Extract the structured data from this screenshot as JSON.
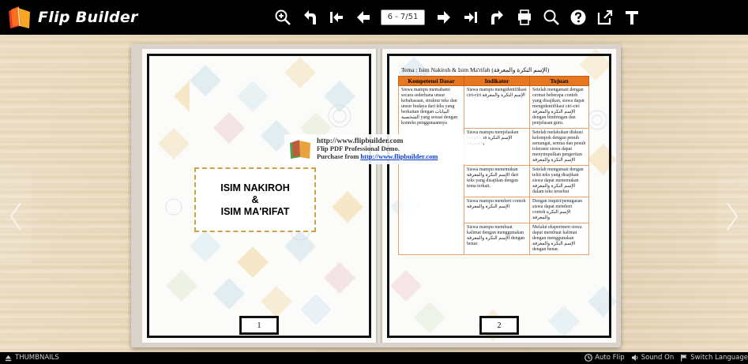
{
  "app": {
    "brand": "Flip Builder"
  },
  "toolbar": {
    "page_indicator": "6 - 7/51",
    "tools": [
      "zoom-in-icon",
      "undo-icon",
      "first-page-icon",
      "prev-page-icon",
      "page-input",
      "next-page-icon",
      "last-page-icon",
      "share-icon",
      "print-icon",
      "search-icon",
      "help-icon",
      "fullscreen-icon",
      "text-icon"
    ]
  },
  "book": {
    "left_page": {
      "title_line1": "ISIM NAKIROH",
      "title_line2": "&",
      "title_line3": "ISIM MA'RIFAT",
      "page_number": "1"
    },
    "right_page": {
      "topic": "Tema : Isim Nakiroh & Isim Ma'rifah (الإسم النكرة والمعرفة)",
      "page_number": "2",
      "table": {
        "headers": [
          "Kompetensi Dasar",
          "Indikator",
          "Tujuan"
        ],
        "kd_text": "Siswa mampu memahami secara sederhana unsur kebahasaan, struktur teks dan unsur budaya dari teks yang berkaitan dengan البيانات الشخصية yang sesuai dengan konteks penggunaannya",
        "rows": [
          {
            "indikator": "Siswa mampu mengidentifikasi ciri-ciri الإسم النكرة والمعرفة",
            "tujuan": "Setelah mengamati dengan cermat beberapa contoh yang disajikan, siswa dapat mengidentifikasi ciri-ciri الإسم النكرة والمعرفة dengan bimbingan dan penjelasan guru."
          },
          {
            "indikator": "Siswa mampu menjelaskan pengertian الإسم النكرة والمعرفة",
            "tujuan": "Setelah melakukan diskusi kelompok dengan penuh semangat, semua dan penuh toleransi siswa dapat menyimpulkan pengertian الإسم النكرة والمعرفة"
          },
          {
            "indikator": "Siswa mampu menemukan الإسم النكرة والمعرفة dari teks yang disajikan dengan tema terkait.",
            "tujuan": "Setelah mengamati dengan teliti teks yang disajikan siswa dapat menemukan الإسم النكرة والمعرفة dalam teks tersebut"
          },
          {
            "indikator": "Siswa mampu memberi contoh الإسم النكرة والمعرفة",
            "tujuan": "Dengan inquiri/penugasan siswa dapat memberi contoh الإسم النكرة والمعرفة"
          },
          {
            "indikator": "Siswa mampu membuat kalimat dengan menggunakan الإسم النكرة والمعرفة dengan benar.",
            "tujuan": "Melalui eksperimen siswa dapat membuat kalimat dengan menggunakan الإسم النكرة والمعرفة dengan benar."
          }
        ]
      }
    }
  },
  "watermark": {
    "url": "http://www.flipbuilder.com",
    "line2": "Flip PDF Professional Demo.",
    "line3_prefix": "Purchase from ",
    "line3_link": "http://www.flipbuilder.com"
  },
  "bottombar": {
    "thumbnails": "THUMBNAILS",
    "auto_flip": "Auto Flip",
    "sound": "Sound On",
    "language": "Switch Language"
  },
  "colors": {
    "toolbar_bg": "#000000",
    "table_header": "#e87722",
    "title_border": "#c9a24a",
    "link": "#0a3fd6"
  }
}
